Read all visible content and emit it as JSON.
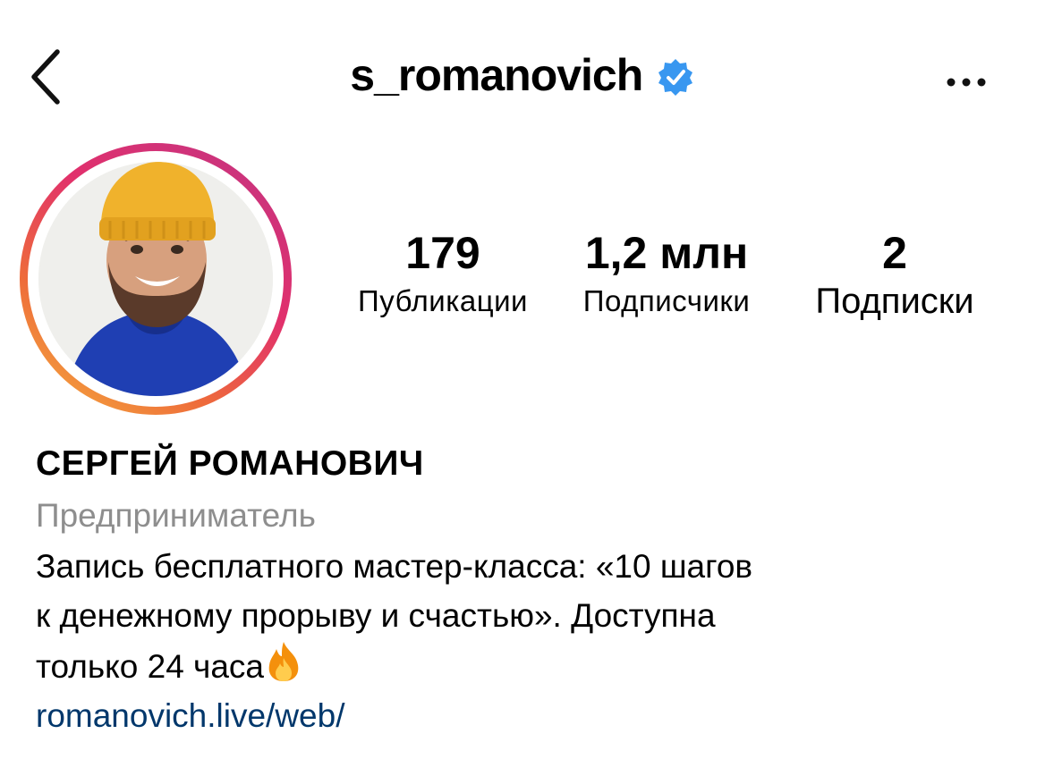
{
  "header": {
    "username": "s_romanovich",
    "back_icon": "chevron-left-icon",
    "verified_icon": "verified-badge-icon",
    "more_icon": "more-horizontal-icon"
  },
  "profile": {
    "avatar_ring_colors": [
      "#f5b33e",
      "#ee6b3a",
      "#e1306c",
      "#c13584"
    ]
  },
  "stats": [
    {
      "value": "179",
      "label": "Публикации"
    },
    {
      "value": "1,2 млн",
      "label": "Подписчики"
    },
    {
      "value": "2",
      "label": "Подписки"
    }
  ],
  "bio": {
    "full_name": "СЕРГЕЙ РОМАНОВИЧ",
    "category": "Предприниматель",
    "lines": [
      "Запись бесплатного мастер-класса: «10 шагов",
      "к денежному прорыву и счастью». Доступна",
      "только 24 часа"
    ],
    "fire_icon": "fire-emoji-icon",
    "link": "romanovich.live/web/"
  },
  "colors": {
    "verified_blue": "#3897f0",
    "link_blue": "#00376b",
    "category_gray": "#8e8e8e"
  }
}
